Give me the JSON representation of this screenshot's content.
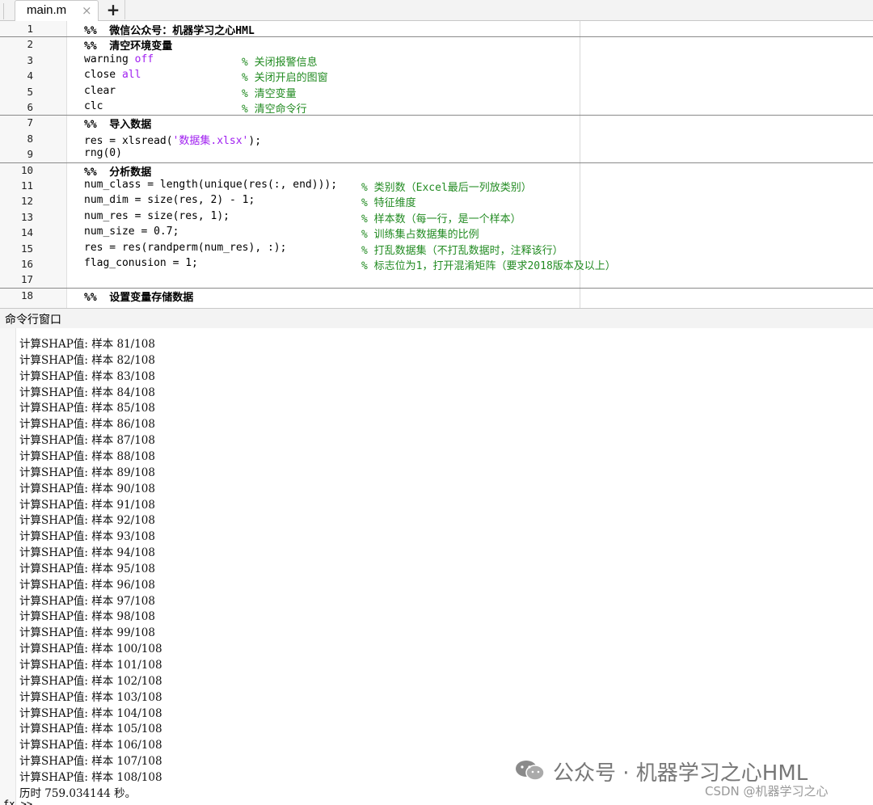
{
  "tabs": {
    "active_label": "main.m",
    "close_glyph": "×",
    "add_glyph": "+"
  },
  "editor": {
    "lines": [
      {
        "n": "1",
        "code": "%%  微信公众号：机器学习之心HML",
        "section": true
      },
      {
        "n": "2",
        "code": "%%  清空环境变量",
        "section": true
      },
      {
        "n": "3",
        "code": "warning off",
        "kw": "off",
        "comment": "% 关闭报警信息"
      },
      {
        "n": "4",
        "code": "close all",
        "kw": "all",
        "comment": "% 关闭开启的图窗"
      },
      {
        "n": "5",
        "code": "clear",
        "comment": "% 清空变量"
      },
      {
        "n": "6",
        "code": "clc",
        "comment": "% 清空命令行"
      },
      {
        "n": "7",
        "code": "%%  导入数据",
        "section": true
      },
      {
        "n": "8",
        "code": "res = xlsread('数据集.xlsx');"
      },
      {
        "n": "9",
        "code": "rng(0)"
      },
      {
        "n": "10",
        "code": "%%  分析数据",
        "section": true
      },
      {
        "n": "11",
        "code": "num_class = length(unique(res(:, end)));",
        "comment": "% 类别数（Excel最后一列放类别）"
      },
      {
        "n": "12",
        "code": "num_dim = size(res, 2) - 1;",
        "comment": "% 特征维度"
      },
      {
        "n": "13",
        "code": "num_res = size(res, 1);",
        "comment": "% 样本数（每一行，是一个样本）"
      },
      {
        "n": "14",
        "code": "num_size = 0.7;",
        "comment": "% 训练集占数据集的比例"
      },
      {
        "n": "15",
        "code": "res = res(randperm(num_res), :);",
        "comment": "% 打乱数据集（不打乱数据时，注释该行）"
      },
      {
        "n": "16",
        "code": "flag_conusion = 1;",
        "comment": "% 标志位为1，打开混淆矩阵（要求2018版本及以上）"
      },
      {
        "n": "17",
        "code": ""
      },
      {
        "n": "18",
        "code": "%%  设置变量存储数据",
        "section": true
      }
    ]
  },
  "command_window": {
    "title": "命令行窗口",
    "output_lines": [
      "计算SHAP值: 样本 81/108",
      "计算SHAP值: 样本 82/108",
      "计算SHAP值: 样本 83/108",
      "计算SHAP值: 样本 84/108",
      "计算SHAP值: 样本 85/108",
      "计算SHAP值: 样本 86/108",
      "计算SHAP值: 样本 87/108",
      "计算SHAP值: 样本 88/108",
      "计算SHAP值: 样本 89/108",
      "计算SHAP值: 样本 90/108",
      "计算SHAP值: 样本 91/108",
      "计算SHAP值: 样本 92/108",
      "计算SHAP值: 样本 93/108",
      "计算SHAP值: 样本 94/108",
      "计算SHAP值: 样本 95/108",
      "计算SHAP值: 样本 96/108",
      "计算SHAP值: 样本 97/108",
      "计算SHAP值: 样本 98/108",
      "计算SHAP值: 样本 99/108",
      "计算SHAP值: 样本 100/108",
      "计算SHAP值: 样本 101/108",
      "计算SHAP值: 样本 102/108",
      "计算SHAP值: 样本 103/108",
      "计算SHAP值: 样本 104/108",
      "计算SHAP值: 样本 105/108",
      "计算SHAP值: 样本 106/108",
      "计算SHAP值: 样本 107/108",
      "计算SHAP值: 样本 108/108",
      "历时 759.034144 秒。"
    ],
    "prompt": "fx >>"
  },
  "watermark": {
    "wechat": "公众号 · 机器学习之心HML",
    "csdn": "CSDN @机器学习之心"
  },
  "colors": {
    "comment": "#228b22",
    "keyword": "#a020f0",
    "string": "#a020f0"
  }
}
